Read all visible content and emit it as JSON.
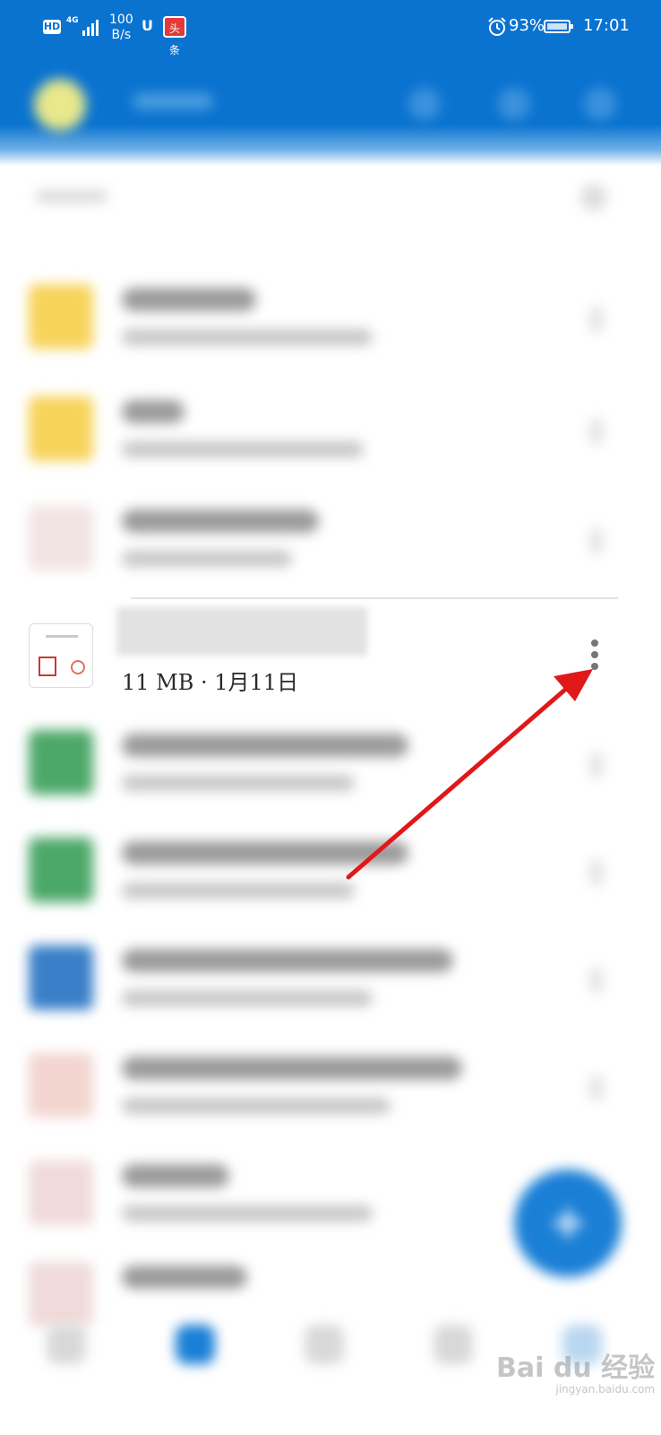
{
  "status_bar": {
    "hd_label": "HD",
    "network_label": "4G",
    "speed_value": "100",
    "speed_unit": "B/s",
    "toutiao_badge": "头条",
    "battery_percent": "93%",
    "time": "17:01"
  },
  "file_list": {
    "focused_item": {
      "meta": "11 MB · 1月11日"
    }
  },
  "watermark": {
    "brand": "Bai du 经验",
    "domain": "jingyan.baidu.com"
  },
  "colors": {
    "header_blue": "#0a73d0",
    "fab_blue": "#1a7fd6",
    "arrow_red": "#e01818"
  },
  "icons": {
    "more": "more-vert-icon",
    "fab": "plus-icon"
  }
}
